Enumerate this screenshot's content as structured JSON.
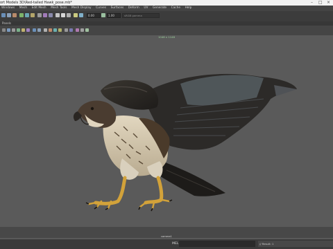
{
  "window": {
    "title": "ort Models 3D\\Red-tailed Hawk_pose.mb*",
    "controls": [
      "–",
      "□",
      "×"
    ]
  },
  "menu": {
    "items": [
      "Windows",
      "Mesh",
      "Edit Mesh",
      "Mesh Tools",
      "Mesh Display",
      "Curves",
      "Surfaces",
      "Deform",
      "UV",
      "Generate",
      "Cache",
      "Help"
    ]
  },
  "shelf": {
    "field_a": "0.00",
    "field_b": "1.00",
    "color_option": "sRGB gamma"
  },
  "panel": {
    "menu_label": "Panels",
    "resolution": "1046 x 1148",
    "camera": "camera1"
  },
  "status": {
    "mel_label": "MEL",
    "result": "// Result: 1"
  },
  "colors": {
    "viewport_bg": "#5a5a5a",
    "menubar_bg": "#444444",
    "titlebar_bg": "#f2f2f2",
    "hud_green": "#9dd39d"
  }
}
